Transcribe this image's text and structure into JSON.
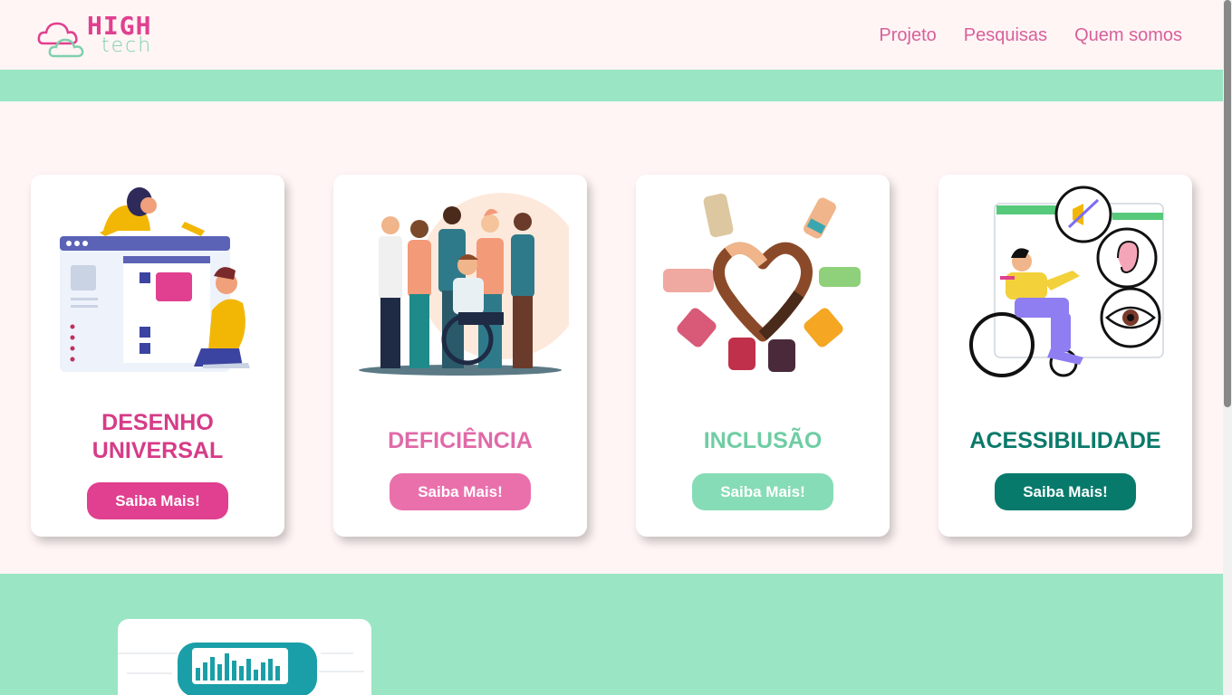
{
  "brand": {
    "line1": "HIGH",
    "line2": "tech"
  },
  "nav": [
    {
      "label": "Projeto"
    },
    {
      "label": "Pesquisas"
    },
    {
      "label": "Quem somos"
    }
  ],
  "cards": [
    {
      "title_line1": "DESENHO",
      "title_line2": "UNIVERSAL",
      "button": "Saiba Mais!",
      "title_color": "#d63c87",
      "button_color": "#e0408f"
    },
    {
      "title": "DEFICIÊNCIA",
      "button": "Saiba Mais!",
      "title_color": "#e06aa8",
      "button_color": "#ea70ac"
    },
    {
      "title": "INCLUSÃO",
      "button": "Saiba Mais!",
      "title_color": "#6fcda3",
      "button_color": "#86dcb6"
    },
    {
      "title": "ACESSIBILIDADE",
      "button": "Saiba Mais!",
      "title_color": "#0b7a6a",
      "button_color": "#087a6b"
    }
  ],
  "colors": {
    "background": "#fff5f5",
    "mint": "#99e5c4",
    "pink": "#e0408f"
  }
}
